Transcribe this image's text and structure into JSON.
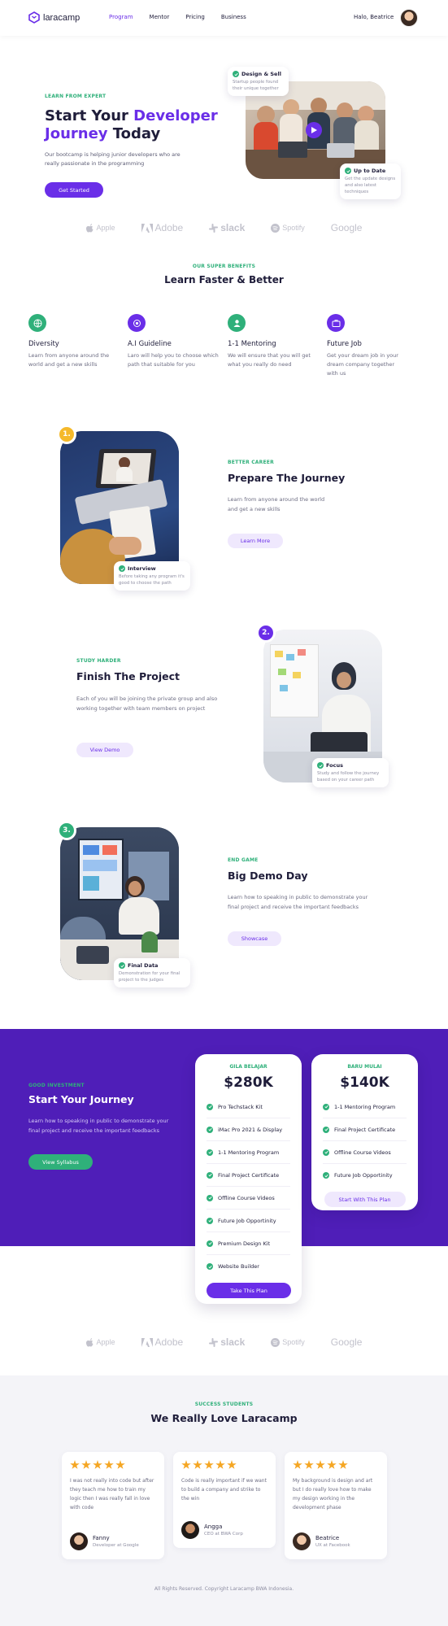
{
  "nav": {
    "brand": "laracamp",
    "links": [
      "Program",
      "Mentor",
      "Pricing",
      "Business"
    ],
    "user_name": "Halo, Beatrice"
  },
  "hero": {
    "eyebrow": "LEARN FROM EXPERT",
    "title_part1": "Start Your ",
    "title_highlight1": "Developer",
    "title_highlight2": "Journey",
    "title_part2": " Today",
    "description": "Our bootcamp is helping junior developers who are really passionate in the programming",
    "cta": "Get Started",
    "card_top_title": "Design & Sell",
    "card_top_desc": "Startup people found their unique together",
    "card_bottom_title": "Up to Date",
    "card_bottom_desc": "Get the update designs and also latest techniques"
  },
  "logos": [
    "Apple",
    "Adobe",
    "slack",
    "Spotify",
    "Google"
  ],
  "benefits": {
    "eyebrow": "OUR SUPER BENEFITS",
    "title": "Learn Faster & Better",
    "items": [
      {
        "title": "Diversity",
        "desc": "Learn from anyone around the world and get a new skills",
        "color": "#2fb07a"
      },
      {
        "title": "A.I Guideline",
        "desc": "Laro will help you to choose which path that suitable for you",
        "color": "#6a2ee8"
      },
      {
        "title": "1-1 Mentoring",
        "desc": "We will ensure that you will get what you really do need",
        "color": "#2fb07a"
      },
      {
        "title": "Future Job",
        "desc": "Get your dream job in your dream company together with us",
        "color": "#6a2ee8"
      }
    ]
  },
  "steps": [
    {
      "num": "1.",
      "eyebrow": "BETTER CAREER",
      "title": "Prepare The Journey",
      "desc": "Learn from anyone around the world and get a new skills",
      "button": "Learn More",
      "card_title": "Interview",
      "card_desc": "Before taking any program it's good to choose the path",
      "badge_color": "#f5b92a"
    },
    {
      "num": "2.",
      "eyebrow": "STUDY HARDER",
      "title": "Finish The Project",
      "desc": "Each of you will be joining the private group and also working together with team members on project",
      "button": "View Demo",
      "card_title": "Focus",
      "card_desc": "Study and follow the journey based on your career path",
      "badge_color": "#6a2ee8"
    },
    {
      "num": "3.",
      "eyebrow": "END GAME",
      "title": "Big Demo Day",
      "desc": "Learn how to speaking in public to demonstrate your final project and receive the important feedbacks",
      "button": "Showcase",
      "card_title": "Final Data",
      "card_desc": "Demonstration for your final project to the judges",
      "badge_color": "#2fb07a"
    }
  ],
  "pricing": {
    "eyebrow": "GOOD INVESTMENT",
    "title": "Start Your Journey",
    "desc": "Learn how to speaking in public to demonstrate your final project and receive the important feedbacks",
    "button": "View Syllabus",
    "plans": [
      {
        "tag": "GILA BELAJAR",
        "price": "$280K",
        "features": [
          "Pro Techstack Kit",
          "iMac Pro 2021 & Display",
          "1-1 Mentoring Program",
          "Final Project Certificate",
          "Offline Course Videos",
          "Future Job Opportinity",
          "Premium Design Kit",
          "Website Builder"
        ],
        "button": "Take This Plan"
      },
      {
        "tag": "BARU MULAI",
        "price": "$140K",
        "features": [
          "1-1 Mentoring Program",
          "Final Project Certificate",
          "Offline Course Videos",
          "Future Job Opportinity"
        ],
        "button": "Start With This Plan"
      }
    ]
  },
  "testimonials": {
    "eyebrow": "SUCCESS STUDENTS",
    "title": "We Really Love Laracamp",
    "items": [
      {
        "text": "I was not really into code but after they teach me how to train my logic then I was really fall in love with code",
        "name": "Fanny",
        "role": "Developer at Google",
        "rating": 5
      },
      {
        "text": "Code is really important if we want to build a company and strike to the win",
        "name": "Angga",
        "role": "CEO at BWA Corp",
        "rating": 5
      },
      {
        "text": "My background is design and art but I do really love how to make my design working in the development phase",
        "name": "Beatrice",
        "role": "UX at Facebook",
        "rating": 5
      }
    ]
  },
  "footer": {
    "text": "All Rights Reserved. Copyright Laracamp BWA Indonesia."
  },
  "colors": {
    "accent": "#6a2ee8",
    "green": "#2fb07a",
    "dark_purple": "#4f1eb8",
    "star": "#f5a623"
  }
}
